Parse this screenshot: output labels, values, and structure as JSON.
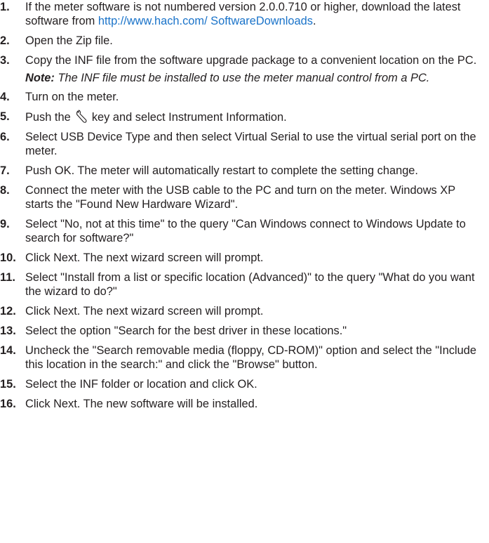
{
  "steps": [
    {
      "num": "1.",
      "text_before": "If the meter software is not numbered version 2.0.0.710 or higher, download the latest software from ",
      "link": "http://www.hach.com/ SoftwareDownloads",
      "text_after": "."
    },
    {
      "num": "2.",
      "text": "Open the Zip file."
    },
    {
      "num": "3.",
      "text": "Copy the INF file from the software upgrade package to a convenient location on the PC."
    },
    {
      "num": "4.",
      "text": "Turn on the meter."
    },
    {
      "num": "5.",
      "text_before": "Push the ",
      "text_after": " key and select Instrument Information."
    },
    {
      "num": "6.",
      "text": "Select USB Device Type and then select Virtual Serial to use the virtual serial port on the meter."
    },
    {
      "num": "7.",
      "text": "Push OK. The meter will automatically restart to complete the setting change."
    },
    {
      "num": "8.",
      "text": "Connect the meter with the USB cable to the PC and turn on the meter. Windows XP starts the \"Found New Hardware Wizard\"."
    },
    {
      "num": "9.",
      "text": "Select \"No, not at this time\" to the query \"Can Windows connect to Windows Update to search for software?\""
    },
    {
      "num": "10.",
      "text": "Click Next. The next wizard screen will prompt."
    },
    {
      "num": "11.",
      "text": "Select \"Install from a list or specific location (Advanced)\" to the query \"What do you want the wizard to do?\""
    },
    {
      "num": "12.",
      "text": "Click Next. The next wizard screen will prompt."
    },
    {
      "num": "13.",
      "text": "Select the option \"Search for the best driver in these locations.\""
    },
    {
      "num": "14.",
      "text": "Uncheck the \"Search removable media (floppy, CD-ROM)\" option and select the \"Include this location in the search:\" and click the \"Browse\" button."
    },
    {
      "num": "15.",
      "text": "Select the INF folder or location and click OK."
    },
    {
      "num": "16.",
      "text": "Click Next. The new software will be installed."
    }
  ],
  "note": {
    "label": "Note:",
    "text": " The INF file must be installed to use the meter manual control from a PC."
  },
  "icons": {
    "settings_key": "wrench-icon"
  },
  "colors": {
    "text": "#231f20",
    "link": "#1a73c9"
  }
}
